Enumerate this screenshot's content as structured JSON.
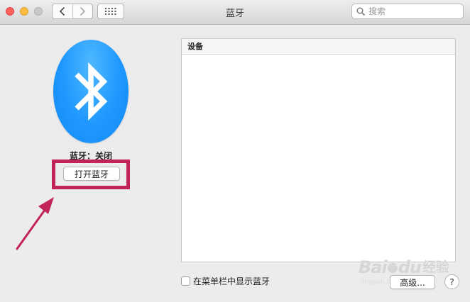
{
  "window": {
    "title": "蓝牙"
  },
  "toolbar": {
    "back_icon": "chevron-left-icon",
    "forward_icon": "chevron-right-icon",
    "grid_icon": "grid-icon",
    "search_placeholder": "搜索"
  },
  "bluetooth": {
    "status": "蓝牙：关闭",
    "turn_on_label": "打开蓝牙",
    "icon_color": "#1e98ff"
  },
  "annotation": {
    "color": "#c2245a"
  },
  "devices": {
    "header": "设备",
    "items": []
  },
  "footer": {
    "show_in_menubar_label": "在菜单栏中显示蓝牙",
    "show_in_menubar_checked": false,
    "advanced_label": "高级...",
    "help_label": "?"
  },
  "watermark": {
    "brand": "Bai",
    "brand_suffix": "du",
    "cn": "经验",
    "sub": "jingyan.baidu.com"
  }
}
